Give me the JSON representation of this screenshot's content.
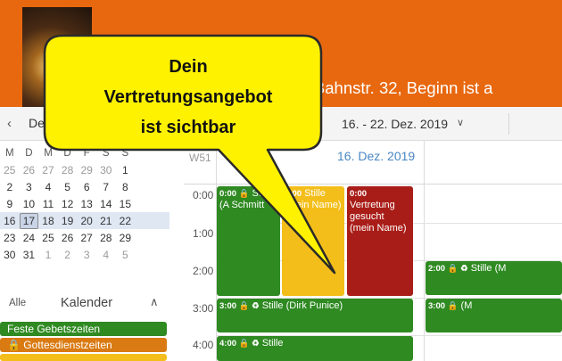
{
  "header": {
    "title": "inz, Bahnstr. 32, Beginn ist a"
  },
  "toolbar": {
    "prev_glyph": "‹",
    "month_label": "De",
    "next_glyph": "›",
    "range_label": "16. - 22. Dez. 2019",
    "range_chevron": "∨"
  },
  "mini_calendar": {
    "headers": [
      "M",
      "D",
      "M",
      "D",
      "F",
      "S",
      "S"
    ],
    "weeks": [
      [
        "25",
        "26",
        "27",
        "28",
        "29",
        "30",
        "1"
      ],
      [
        "2",
        "3",
        "4",
        "5",
        "6",
        "7",
        "8"
      ],
      [
        "9",
        "10",
        "11",
        "12",
        "13",
        "14",
        "15"
      ],
      [
        "16",
        "17",
        "18",
        "19",
        "20",
        "21",
        "22"
      ],
      [
        "23",
        "24",
        "25",
        "26",
        "27",
        "28",
        "29"
      ],
      [
        "30",
        "31",
        "1",
        "2",
        "3",
        "4",
        "5"
      ]
    ],
    "today": "17"
  },
  "calendars": {
    "all_label": "Alle",
    "title": "Kalender",
    "chevron": "∧",
    "items": [
      {
        "label": "Feste Gebetszeiten",
        "color": "#2f8a22"
      },
      {
        "label": "🔒 Gottesdienstzeiten",
        "color": "#d97a12"
      },
      {
        "label": "",
        "color": "#f4be1a"
      }
    ]
  },
  "grid": {
    "week_label": "W51",
    "day_header": "16. Dez. 2019",
    "times": [
      "0:00",
      "1:00",
      "2:00",
      "3:00",
      "4:00"
    ]
  },
  "events": {
    "e1": {
      "time": "0:00 🔒",
      "text": "Stille (A Schmitt"
    },
    "e2": {
      "time": "0:00",
      "text": "Stille (mein Name)"
    },
    "e3": {
      "time": "0:00",
      "text": "Vertretung gesucht (mein Name)"
    },
    "e4": {
      "time": "2:00 🔒 ♻",
      "text": "Stille (M"
    },
    "e5": {
      "time": "3:00 🔒 ♻",
      "text": "Stille (Dirk Punice)"
    },
    "e6": {
      "time": "3:00 🔒",
      "text": "(M"
    },
    "e7": {
      "time": "4:00 🔒 ♻",
      "text": "Stille"
    }
  },
  "callout": {
    "line1": "Dein",
    "line2": "Vertretungsangebot",
    "line3": "ist sichtbar"
  },
  "colors": {
    "header": "#e8680f",
    "callout_fill": "#fff200",
    "accent_blue": "#4a86c4"
  }
}
